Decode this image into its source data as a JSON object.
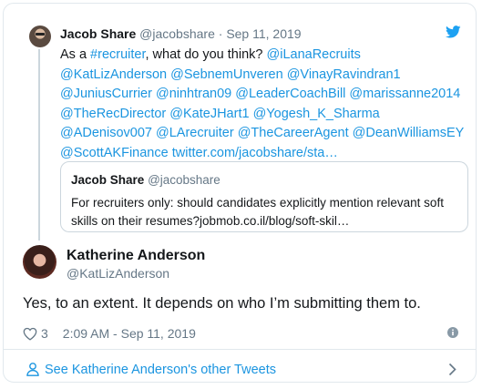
{
  "parent_tweet": {
    "author_name": "Jacob Share",
    "author_handle": "@jacobshare",
    "separator": "·",
    "date": "Sep 11, 2019",
    "text_segments": [
      {
        "t": "As a ",
        "link": false
      },
      {
        "t": "#recruiter",
        "link": true
      },
      {
        "t": ", what do you think? ",
        "link": false
      },
      {
        "t": "@iLanaRecruits",
        "link": true
      },
      {
        "t": " ",
        "link": false
      },
      {
        "t": "@KatLizAnderson",
        "link": true
      },
      {
        "t": " ",
        "link": false
      },
      {
        "t": "@SebnemUnveren",
        "link": true
      },
      {
        "t": " ",
        "link": false
      },
      {
        "t": "@VinayRavindran1",
        "link": true
      },
      {
        "t": " ",
        "link": false
      },
      {
        "t": "@JuniusCurrier",
        "link": true
      },
      {
        "t": " ",
        "link": false
      },
      {
        "t": "@ninhtran09",
        "link": true
      },
      {
        "t": " ",
        "link": false
      },
      {
        "t": "@LeaderCoachBill",
        "link": true
      },
      {
        "t": " ",
        "link": false
      },
      {
        "t": "@marissanne2014",
        "link": true
      },
      {
        "t": " ",
        "link": false
      },
      {
        "t": "@TheRecDirector",
        "link": true
      },
      {
        "t": " ",
        "link": false
      },
      {
        "t": "@KateJHart1",
        "link": true
      },
      {
        "t": " ",
        "link": false
      },
      {
        "t": "@Yogesh_K_Sharma",
        "link": true
      },
      {
        "t": " ",
        "link": false
      },
      {
        "t": "@ADenisov007",
        "link": true
      },
      {
        "t": " ",
        "link": false
      },
      {
        "t": "@LArecruiter",
        "link": true
      },
      {
        "t": " ",
        "link": false
      },
      {
        "t": "@TheCareerAgent",
        "link": true
      },
      {
        "t": " ",
        "link": false
      },
      {
        "t": "@DeanWilliamsEY",
        "link": true
      },
      {
        "t": " ",
        "link": false
      },
      {
        "t": "@ScottAKFinance",
        "link": true
      },
      {
        "t": " ",
        "link": false
      },
      {
        "t": "twitter.com/jacobshare/sta…",
        "link": true
      }
    ],
    "quoted": {
      "author_name": "Jacob Share",
      "author_handle": "@jacobshare",
      "text": "For recruiters only: should candidates explicitly mention relevant soft skills on their resumes?jobmob.co.il/blog/soft-skil…"
    }
  },
  "reply_tweet": {
    "author_name": "Katherine Anderson",
    "author_handle": "@KatLizAnderson",
    "text": "Yes, to an extent. It depends on who I’m submitting them to.",
    "like_count": "3",
    "timestamp": "2:09 AM - Sep 11, 2019"
  },
  "footer": {
    "see_more": "See Katherine Anderson's other Tweets"
  },
  "colors": {
    "link": "#1b95e0",
    "muted": "#657786",
    "border": "#e1e8ed",
    "text": "#14171a"
  },
  "icons": [
    "twitter-bird-icon",
    "heart-icon",
    "info-icon",
    "person-icon",
    "chevron-right-icon"
  ]
}
